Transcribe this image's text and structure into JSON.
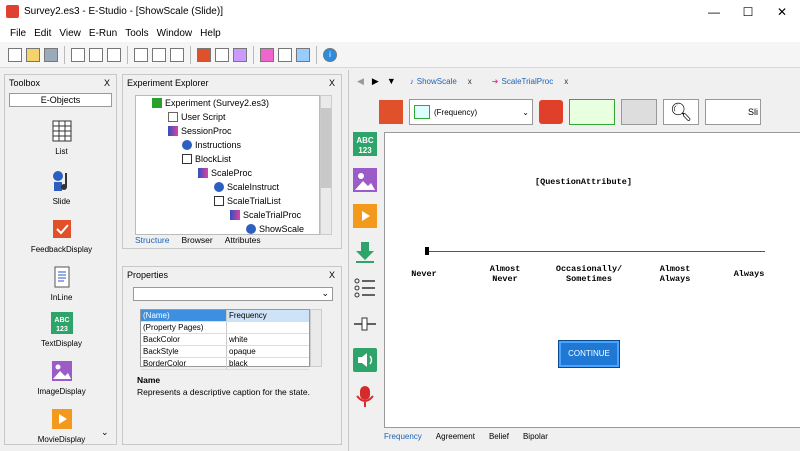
{
  "window": {
    "title": "Survey2.es3 - E-Studio - [ShowScale (Slide)]",
    "minimize": "—",
    "maximize": "☐",
    "close": "✕"
  },
  "menu": [
    "File",
    "Edit",
    "View",
    "E-Run",
    "Tools",
    "Window",
    "Help"
  ],
  "toolbox": {
    "title": "Toolbox",
    "close": "X",
    "category": "E-Objects",
    "items": [
      "List",
      "Slide",
      "FeedbackDisplay",
      "InLine",
      "TextDisplay",
      "ImageDisplay",
      "MovieDisplay"
    ]
  },
  "explorer": {
    "title": "Experiment Explorer",
    "close": "X",
    "tree": [
      "Experiment (Survey2.es3)",
      "User Script",
      "SessionProc",
      "Instructions",
      "BlockList",
      "ScaleProc",
      "ScaleInstruct",
      "ScaleTrialList",
      "ScaleTrialProc",
      "ShowScale"
    ],
    "tabs": [
      "Structure",
      "Browser",
      "Attributes"
    ]
  },
  "properties": {
    "title": "Properties",
    "close": "X",
    "rows": [
      {
        "key": "(Name)",
        "value": "Frequency"
      },
      {
        "key": "(Property Pages)",
        "value": ""
      },
      {
        "key": "BackColor",
        "value": "white"
      },
      {
        "key": "BackStyle",
        "value": "opaque"
      },
      {
        "key": "BorderColor",
        "value": "black"
      }
    ],
    "desc_title": "Name",
    "desc_text": "Represents a descriptive caption for the state."
  },
  "editor": {
    "doc_tabs": [
      "ShowScale",
      "ScaleTrialProc"
    ],
    "tab_close": "x",
    "combo_value": "(Frequency)",
    "overflow_label": "Sli",
    "canvas": {
      "question": "[QuestionAttribute]",
      "scale_labels": [
        [
          "Never"
        ],
        [
          "Almost",
          "Never"
        ],
        [
          "Occasionally/",
          "Sometimes"
        ],
        [
          "Almost",
          "Always"
        ],
        [
          "Always"
        ]
      ],
      "continue_label": "CONTINUE"
    },
    "bottom_tabs": [
      "Frequency",
      "Agreement",
      "Belief",
      "Bipolar"
    ]
  },
  "colors": {
    "accent": "#1e78d4",
    "tab_text": "#1a63b8"
  }
}
